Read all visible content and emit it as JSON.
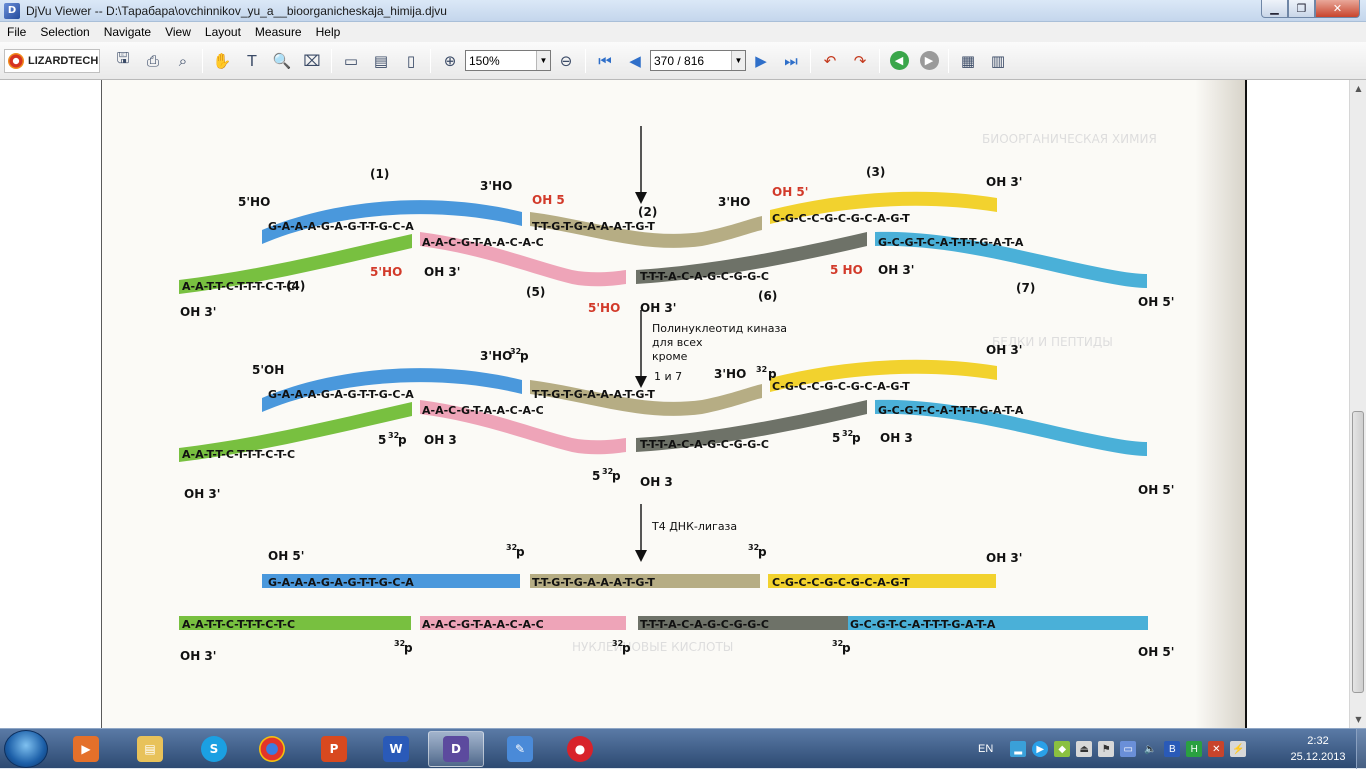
{
  "window": {
    "title": "DjVu Viewer -- D:\\Тарабара\\ovchinnikov_yu_a__bioorganicheskaja_himija.djvu",
    "app_icon": "djvu-icon"
  },
  "menu": [
    "File",
    "Selection",
    "Navigate",
    "View",
    "Layout",
    "Measure",
    "Help"
  ],
  "toolbar": {
    "brand": "LIZARDTECH",
    "zoom_value": "150%",
    "page_value": "370 / 816"
  },
  "figure": {
    "colors": {
      "blue": "#4a98dc",
      "khaki": "#b6ad84",
      "yellow": "#f2d22e",
      "green": "#78c040",
      "pink": "#eea4b8",
      "dark": "#6e7268",
      "teal": "#4ab0d8"
    },
    "strand_labels": [
      "(1)",
      "(2)",
      "(3)",
      "(4)",
      "(5)",
      "(6)",
      "(7)"
    ],
    "seq": {
      "s1": "G-A-A-A-G-A-G-T-T-G-C-A",
      "s2": "T-T-G-T-G-A-A-A-T-G-T",
      "s3": "C-G-C-C-G-C-G-C-A-G-T",
      "s4": "A-A-T-T-C-T-T-T-C-T-C",
      "s5": "A-A-C-G-T-A-A-C-A-C",
      "s6": "T-T-T-A-C-A-G-C-G-G-C",
      "s7": "G-C-G-T-C-A-T-T-T-G-A-T-A"
    },
    "ends": {
      "ho5": "5'HO",
      "oh3": "OH 3'",
      "oh5_red": "OH 5'",
      "oh5_red_plain": "OH 5",
      "ho3": "3'HO",
      "ho5_red": "5'HO",
      "ho5_red_spaced": "5 HO",
      "oh5": "OH 5'",
      "oh3_plain": "OH 3",
      "oh5_start": "5'OH",
      "oh5_final": "OH 5'",
      "ho3_32p": "3'HO",
      "p32": "32",
      "p": "p",
      "p5_32": "5",
      "ho3_start": "3'HO"
    },
    "arrows": {
      "kinase": "Полинуклеотид киназа",
      "kinase2": "для всех",
      "kinase3": "кроме",
      "kinase4": "1 и 7",
      "ligase": "T4 ДНК-лигаза"
    },
    "bleed_text": [
      "БИООРГАНИЧЕСКАЯ ХИМИЯ",
      "БЕЛКИ И ПЕПТИДЫ",
      "НУКЛЕИНОВЫЕ КИСЛОТЫ"
    ]
  },
  "taskbar": {
    "lang": "EN",
    "time": "2:32",
    "date": "25.12.2013",
    "apps": [
      "start-orb",
      "media-player",
      "file-explorer",
      "skype",
      "chrome",
      "presentation",
      "word",
      "djvu-viewer",
      "notes",
      "recorder"
    ]
  }
}
